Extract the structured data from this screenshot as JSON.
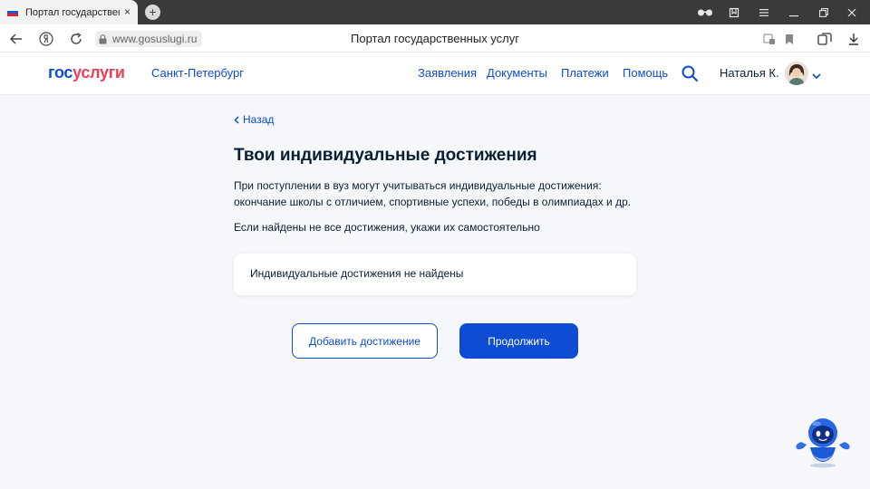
{
  "browser": {
    "tab_title": "Портал государственных услуг",
    "tab_close": "×",
    "new_tab": "+",
    "url": "www.gosuslugi.ru",
    "page_title": "Портал государственных услуг"
  },
  "header": {
    "logo_part1": "гос",
    "logo_part2": "услуги",
    "city": "Санкт-Петербург",
    "nav": [
      "Заявления",
      "Документы",
      "Платежи",
      "Помощь"
    ],
    "user_name": "Наталья К."
  },
  "main": {
    "back_label": "Назад",
    "title": "Твои индивидуальные достижения",
    "description_line1": "При поступлении в вуз могут учитываться индивидуальные достижения:",
    "description_line2": "окончание школы с отличием, спортивные успехи, победы в олимпиадах и др.",
    "hint": "Если найдены не все достижения, укажи их самостоятельно",
    "empty_message": "Индивидуальные достижения не найдены",
    "add_button": "Добавить достижение",
    "continue_button": "Продолжить"
  },
  "colors": {
    "brand_blue": "#0d4cd3",
    "brand_red": "#ee3f58",
    "background": "#f5f7fa",
    "text": "#0b1f33"
  }
}
